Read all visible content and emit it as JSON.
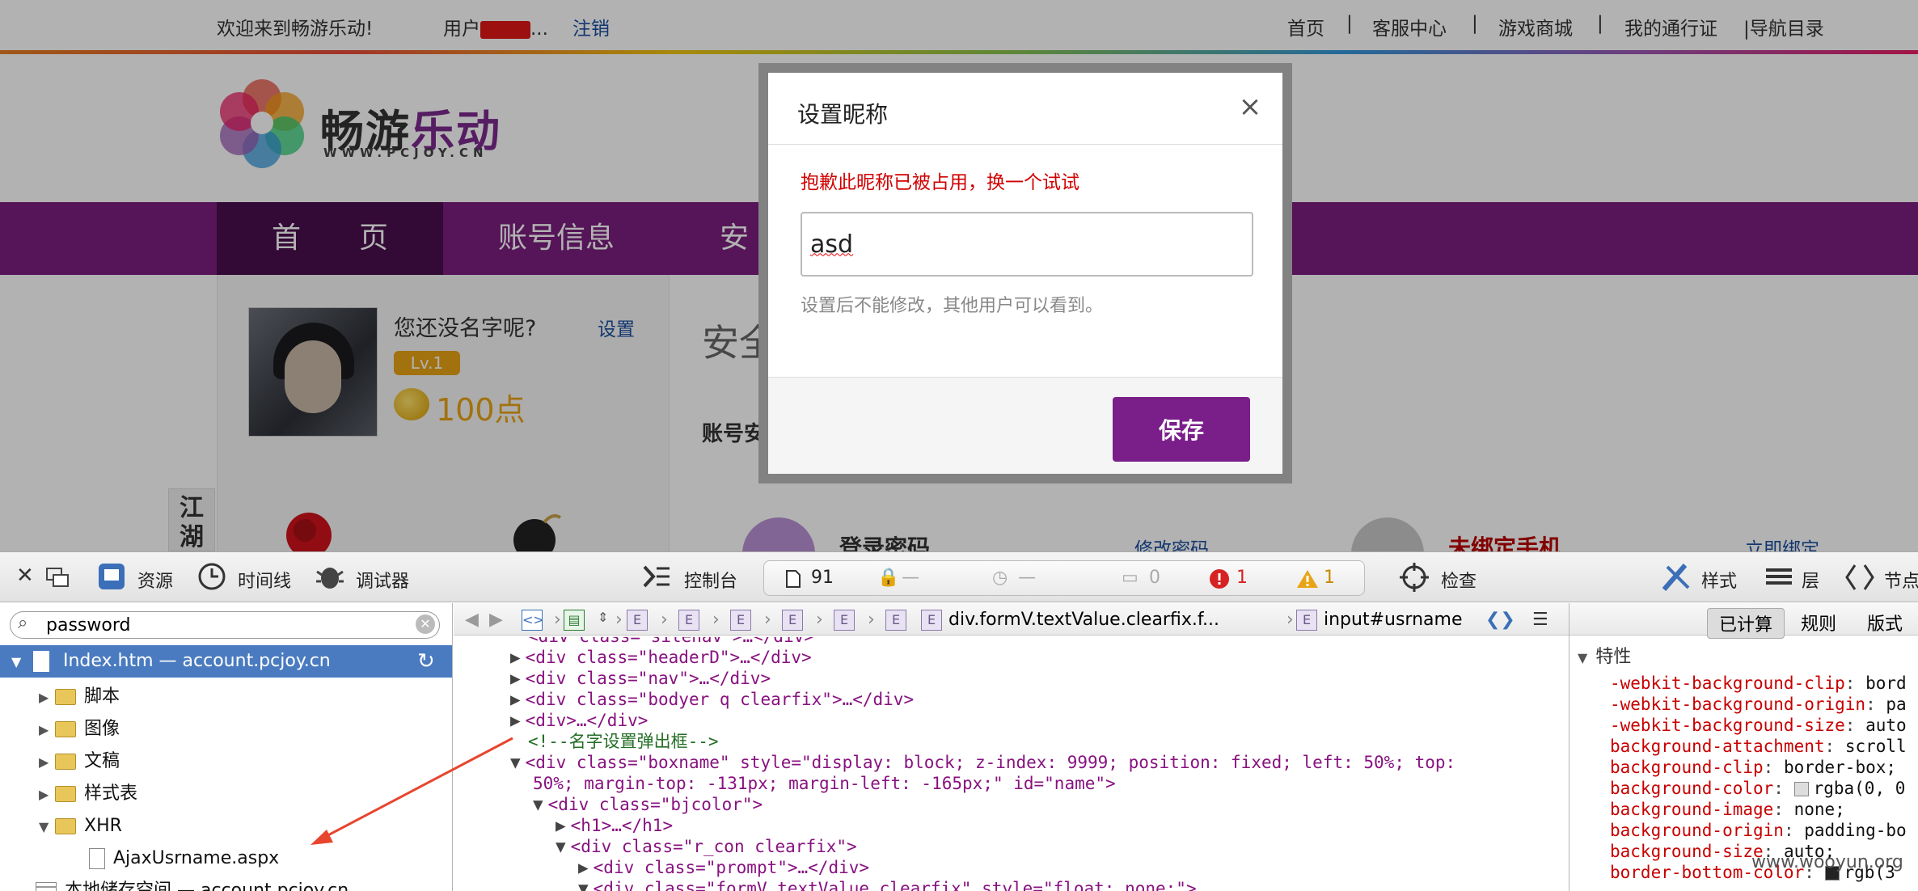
{
  "topbar": {
    "welcome": "欢迎来到畅游乐动!",
    "user": "用户",
    "user_suffix": "...",
    "logout": "注销",
    "links": [
      "首页",
      "|",
      "客服中心",
      "|",
      "游戏商城",
      "|",
      "我的通行证",
      "|导航目录"
    ]
  },
  "logo": {
    "cn_a": "畅游",
    "cn_b": "乐动",
    "en": "WWW.PCJOY.CN"
  },
  "nav": {
    "items": [
      "首　　页",
      "账号信息",
      "安"
    ]
  },
  "profile": {
    "nick_question": "您还没名字呢?",
    "set_link": "设置",
    "level": "Lv.1",
    "points": "100点",
    "side_tab": "江湖"
  },
  "main": {
    "title": "安全",
    "subtitle": "账号安",
    "login_pw": "登录密码",
    "modify_pw": "修改密码",
    "unbound_phone": "未绑定手机",
    "bind_now": "立即绑定"
  },
  "dialog": {
    "title": "设置昵称",
    "close": "×",
    "error": "抱歉此昵称已被占用，换一个试试",
    "input_value": "asd",
    "hint": "设置后不能修改，其他用户可以看到。",
    "save": "保存"
  },
  "devtools": {
    "toolbar": {
      "close": "✕",
      "resources": "资源",
      "timeline": "时间线",
      "debugger": "调试器",
      "console": "控制台",
      "inspect": "检查",
      "styles": "样式",
      "layers": "层",
      "nodes": "节点"
    },
    "dashboard": {
      "resources": "91",
      "dash1": "—",
      "dash2": "—",
      "logs": "0",
      "errors": "1",
      "warnings": "1"
    },
    "filter": {
      "value": "password"
    },
    "tree": {
      "head": "Index.htm — account.pcjoy.cn",
      "items": [
        "脚本",
        "图像",
        "文稿",
        "样式表",
        "XHR",
        "AjaxUsrname.aspx",
        "本地储存空间 — account.pcjoy.cn"
      ]
    },
    "breadcrumb": {
      "last_div": "div.formV.textValue.clearfix.f...",
      "input": "input#usrname"
    },
    "code": [
      {
        "t": "<div class=\"sitenav\">…</div>"
      },
      {
        "t": "<div class=\"headerD\">…</div>"
      },
      {
        "t": "<div class=\"nav\">…</div>"
      },
      {
        "t": "<div class=\"bodyer q clearfix\">…</div>"
      },
      {
        "t": "<div>…</div>"
      },
      {
        "t": "<!--名字设置弹出框-->"
      },
      {
        "t": "<div class=\"boxname\" style=\"display: block; z-index: 9999; position: fixed; left: 50%; top:"
      },
      {
        "t": "50%; margin-top: -131px; margin-left: -165px;\" id=\"name\">"
      },
      {
        "t": "<div class=\"bjcolor\">"
      },
      {
        "t": "<h1>…</h1>"
      },
      {
        "t": "<div class=\"r_con clearfix\">"
      },
      {
        "t": "<div class=\"prompt\">…</div>"
      },
      {
        "t": "<div class=\"formV textValue clearfix\" style=\"float: none;\">"
      }
    ],
    "right": {
      "tabs": [
        "已计算",
        "规则",
        "版式"
      ],
      "section": "特性",
      "props": [
        {
          "n": "-webkit-background-clip",
          "v": "bord"
        },
        {
          "n": "-webkit-background-origin",
          "v": "pa"
        },
        {
          "n": "-webkit-background-size",
          "v": "auto"
        },
        {
          "n": "background-attachment",
          "v": "scroll"
        },
        {
          "n": "background-clip",
          "v": "border-box;"
        },
        {
          "n": "background-color",
          "v": "rgba(0, 0"
        },
        {
          "n": "background-image",
          "v": "none;"
        },
        {
          "n": "background-origin",
          "v": "padding-bo"
        },
        {
          "n": "background-size",
          "v": "auto;"
        },
        {
          "n": "border-bottom-color",
          "v": "rgb(3"
        }
      ]
    }
  },
  "watermark": "www.wooyun.org",
  "colors": {
    "brand_purple": "#7a1f7f",
    "nav_active": "#4a0d4e",
    "error_red": "#d10000",
    "link_blue": "#1a4fa0",
    "gold": "#e8a416"
  }
}
